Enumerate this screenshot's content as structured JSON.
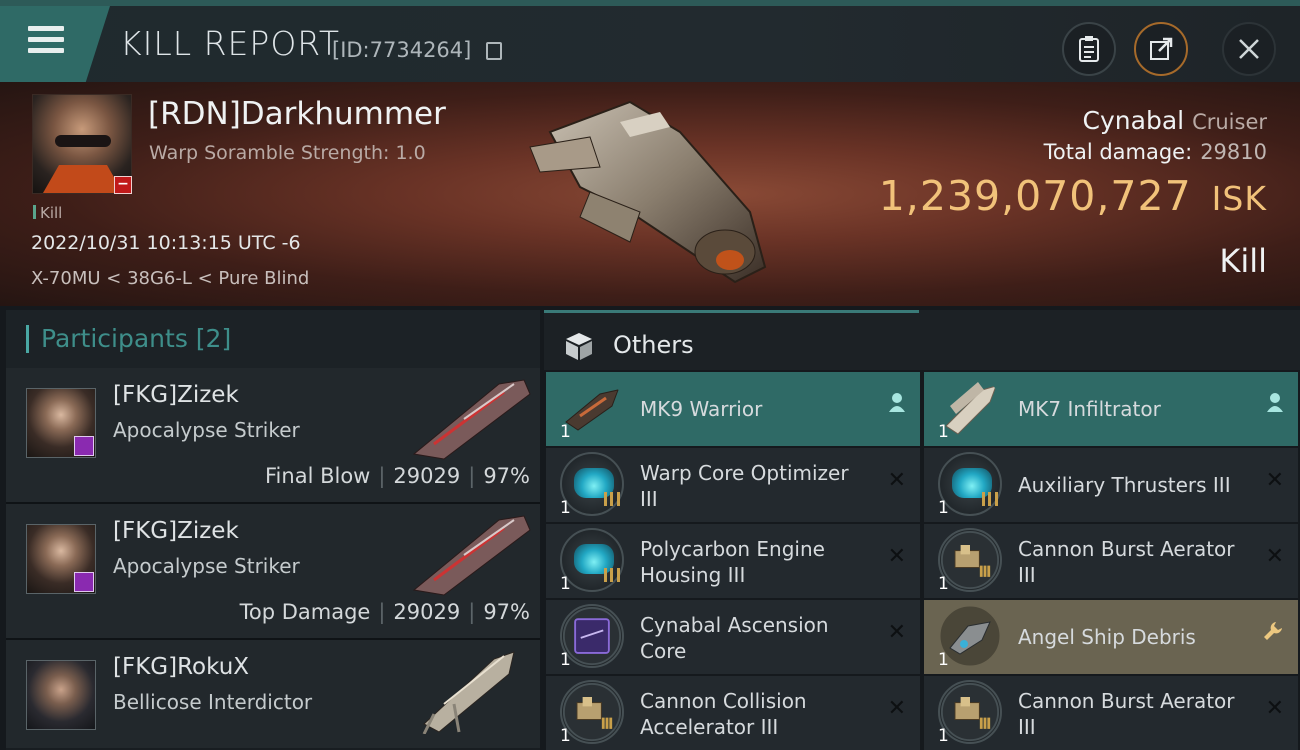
{
  "header": {
    "title": "KILL REPORT",
    "report_id": "[ID:7734264]",
    "icons": {
      "menu": "menu-icon",
      "copy": "copy-icon",
      "clipboard": "clipboard-icon",
      "share": "share-icon",
      "close": "close-icon"
    }
  },
  "victim": {
    "name": "[RDN]Darkhummer",
    "subtitle": "Warp Soramble Strength: 1.0",
    "tag": "Kill",
    "datetime": "2022/10/31 10:13:15 UTC -6",
    "location": "X-70MU < 38G6-L < Pure Blind",
    "ship": "Cynabal",
    "ship_class": "Cruiser",
    "total_damage_label": "Total damage:",
    "total_damage": "29810",
    "isk_value": "1,239,070,727",
    "isk_unit": "ISK",
    "result": "Kill"
  },
  "colors": {
    "accent_teal": "#2f6a66",
    "isk_gold": "#f1c27a",
    "debris_gold": "#6a6451"
  },
  "participants": {
    "title": "Participants [2]",
    "rows": [
      {
        "name": "[FKG]Zizek",
        "ship": "Apocalypse Striker",
        "label": "Final Blow",
        "damage": "29029",
        "percent": "97%"
      },
      {
        "name": "[FKG]Zizek",
        "ship": "Apocalypse Striker",
        "label": "Top Damage",
        "damage": "29029",
        "percent": "97%"
      },
      {
        "name": "[FKG]RokuX",
        "ship": "Bellicose Interdictor"
      }
    ]
  },
  "others": {
    "title": "Others",
    "items": [
      {
        "label": "MK9  Warrior",
        "qty": "1",
        "action": "person-icon"
      },
      {
        "label": "MK7  Infiltrator",
        "qty": "1",
        "action": "person-icon"
      },
      {
        "label": "Warp Core Optimizer III",
        "qty": "1",
        "action": "close-icon"
      },
      {
        "label": "Auxiliary Thrusters III",
        "qty": "1",
        "action": "close-icon"
      },
      {
        "label": "Polycarbon Engine Housing III",
        "qty": "1",
        "action": "close-icon"
      },
      {
        "label": "Cannon Burst Aerator III",
        "qty": "1",
        "action": "close-icon"
      },
      {
        "label": "Cynabal Ascension Core",
        "qty": "1",
        "action": "close-icon"
      },
      {
        "label": "Angel Ship Debris",
        "qty": "1",
        "action": "wrench-icon"
      },
      {
        "label": "Cannon Collision Accelerator III",
        "qty": "1",
        "action": "close-icon"
      },
      {
        "label": "Cannon Burst Aerator III",
        "qty": "1",
        "action": "close-icon"
      }
    ]
  }
}
